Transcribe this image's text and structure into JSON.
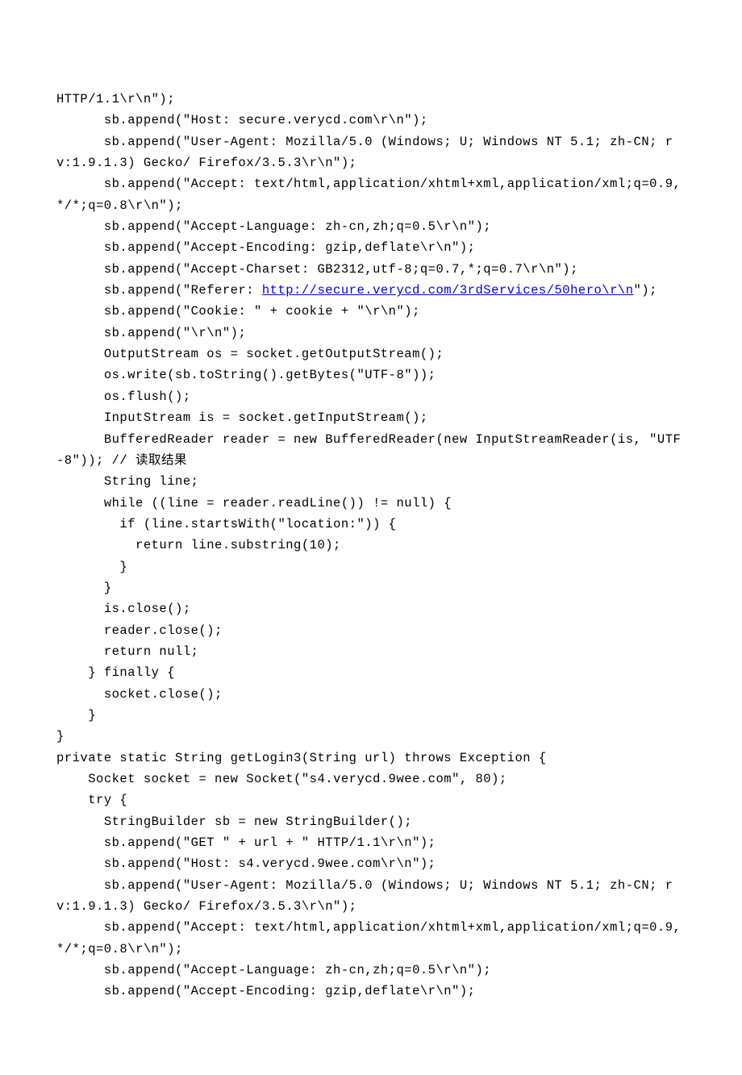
{
  "code_lines": [
    {
      "text": "HTTP/1.1\\r\\n\");"
    },
    {
      "text": "      sb.append(\"Host: secure.verycd.com\\r\\n\");"
    },
    {
      "text": "      sb.append(\"User-Agent: Mozilla/5.0 (Windows; U; Windows NT 5.1; zh-CN; rv:1.9.1.3) Gecko/ Firefox/3.5.3\\r\\n\");"
    },
    {
      "text": "      sb.append(\"Accept: text/html,application/xhtml+xml,application/xml;q=0.9,*/*;q=0.8\\r\\n\");"
    },
    {
      "text": "      sb.append(\"Accept-Language: zh-cn,zh;q=0.5\\r\\n\");"
    },
    {
      "text": "      sb.append(\"Accept-Encoding: gzip,deflate\\r\\n\");"
    },
    {
      "text": "      sb.append(\"Accept-Charset: GB2312,utf-8;q=0.7,*;q=0.7\\r\\n\");"
    },
    {
      "text": "      sb.append(\"Referer: ",
      "link": "http://secure.verycd.com/3rdServices/50hero\\r\\n",
      "after": "\");"
    },
    {
      "text": "      sb.append(\"Cookie: \" + cookie + \"\\r\\n\");"
    },
    {
      "text": "      sb.append(\"\\r\\n\");"
    },
    {
      "text": "      OutputStream os = socket.getOutputStream();"
    },
    {
      "text": "      os.write(sb.toString().getBytes(\"UTF-8\"));"
    },
    {
      "text": "      os.flush();"
    },
    {
      "text": "      InputStream is = socket.getInputStream();"
    },
    {
      "text": "      BufferedReader reader = new BufferedReader(new InputStreamReader(is, \"UTF-8\")); // 读取结果"
    },
    {
      "text": "      String line;"
    },
    {
      "text": "      while ((line = reader.readLine()) != null) {"
    },
    {
      "text": "        if (line.startsWith(\"location:\")) {"
    },
    {
      "text": "          return line.substring(10);"
    },
    {
      "text": "        }"
    },
    {
      "text": "      }"
    },
    {
      "text": "      is.close();"
    },
    {
      "text": "      reader.close();"
    },
    {
      "text": "      return null;"
    },
    {
      "text": "    } finally {"
    },
    {
      "text": "      socket.close();"
    },
    {
      "text": "    }"
    },
    {
      "text": "}"
    },
    {
      "text": "private static String getLogin3(String url) throws Exception {"
    },
    {
      "text": "    Socket socket = new Socket(\"s4.verycd.9wee.com\", 80);"
    },
    {
      "text": "    try {"
    },
    {
      "text": "      StringBuilder sb = new StringBuilder();"
    },
    {
      "text": "      sb.append(\"GET \" + url + \" HTTP/1.1\\r\\n\");"
    },
    {
      "text": "      sb.append(\"Host: s4.verycd.9wee.com\\r\\n\");"
    },
    {
      "text": "      sb.append(\"User-Agent: Mozilla/5.0 (Windows; U; Windows NT 5.1; zh-CN; rv:1.9.1.3) Gecko/ Firefox/3.5.3\\r\\n\");"
    },
    {
      "text": "      sb.append(\"Accept: text/html,application/xhtml+xml,application/xml;q=0.9,*/*;q=0.8\\r\\n\");"
    },
    {
      "text": "      sb.append(\"Accept-Language: zh-cn,zh;q=0.5\\r\\n\");"
    },
    {
      "text": "      sb.append(\"Accept-Encoding: gzip,deflate\\r\\n\");"
    }
  ]
}
